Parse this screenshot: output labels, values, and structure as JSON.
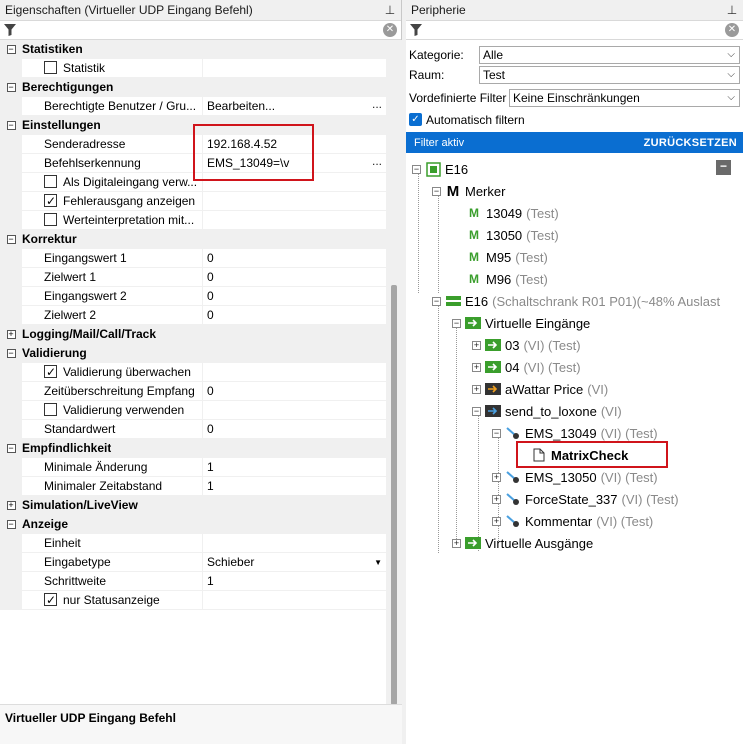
{
  "left_panel": {
    "title": "Eigenschaften (Virtueller UDP Eingang Befehl)",
    "description": "Virtueller UDP Eingang Befehl"
  },
  "right_panel": {
    "title": "Peripherie",
    "kategorie_label": "Kategorie:",
    "kategorie_value": "Alle",
    "raum_label": "Raum:",
    "raum_value": "Test",
    "vordef_label": "Vordefinierte Filter",
    "vordef_value": "Keine Einschränkungen",
    "auto_filter": "Automatisch filtern",
    "filter_active": "Filter aktiv",
    "reset": "ZURÜCKSETZEN"
  },
  "props": [
    {
      "t": "cat",
      "name": "Statistiken"
    },
    {
      "t": "cb",
      "name": "Statistik",
      "checked": false,
      "val": ""
    },
    {
      "t": "cat",
      "name": "Berechtigungen"
    },
    {
      "t": "row",
      "name": "Berechtigte Benutzer / Gru...",
      "val": "Bearbeiten...",
      "ell": true
    },
    {
      "t": "cat",
      "name": "Einstellungen"
    },
    {
      "t": "row",
      "name": "Senderadresse",
      "val": "192.168.4.52"
    },
    {
      "t": "row",
      "name": "Befehlserkennung",
      "val": "EMS_13049=\\v",
      "ell": true
    },
    {
      "t": "cb",
      "name": "Als Digitaleingang verw...",
      "checked": false,
      "val": ""
    },
    {
      "t": "cb",
      "name": "Fehlerausgang anzeigen",
      "checked": true,
      "val": ""
    },
    {
      "t": "cb",
      "name": "Werteinterpretation mit...",
      "checked": false,
      "val": ""
    },
    {
      "t": "cat",
      "name": "Korrektur"
    },
    {
      "t": "row",
      "name": "Eingangswert 1",
      "val": "0"
    },
    {
      "t": "row",
      "name": "Zielwert 1",
      "val": "0"
    },
    {
      "t": "row",
      "name": "Eingangswert 2",
      "val": "0"
    },
    {
      "t": "row",
      "name": "Zielwert 2",
      "val": "0"
    },
    {
      "t": "catc",
      "name": "Logging/Mail/Call/Track"
    },
    {
      "t": "cat",
      "name": "Validierung"
    },
    {
      "t": "cb",
      "name": "Validierung überwachen",
      "checked": true,
      "val": ""
    },
    {
      "t": "row",
      "name": "Zeitüberschreitung Empfang",
      "val": "0"
    },
    {
      "t": "cb",
      "name": "Validierung verwenden",
      "checked": false,
      "val": ""
    },
    {
      "t": "row",
      "name": "Standardwert",
      "val": "0"
    },
    {
      "t": "cat",
      "name": "Empfindlichkeit"
    },
    {
      "t": "row",
      "name": "Minimale Änderung",
      "val": "1"
    },
    {
      "t": "row",
      "name": "Minimaler Zeitabstand",
      "val": "1"
    },
    {
      "t": "catc",
      "name": "Simulation/LiveView"
    },
    {
      "t": "cat",
      "name": "Anzeige"
    },
    {
      "t": "row",
      "name": "Einheit",
      "val": ""
    },
    {
      "t": "row",
      "name": "Eingabetype",
      "val": "Schieber",
      "dd": true
    },
    {
      "t": "row",
      "name": "Schrittweite",
      "val": "1"
    },
    {
      "t": "cb",
      "name": "nur Statusanzeige",
      "checked": true,
      "val": ""
    }
  ],
  "tree": {
    "e16": "E16",
    "merker": "Merker",
    "m1": "13049",
    "m1s": "(Test)",
    "m2": "13050",
    "m2s": "(Test)",
    "m3": "M95",
    "m3s": "(Test)",
    "m4": "M96",
    "m4s": "(Test)",
    "e16b": "E16",
    "e16bs": "(Schaltschrank R01 P01)(~48% Auslast",
    "ve": "Virtuelle Eingänge",
    "v1": "03",
    "v1s": "(VI) (Test)",
    "v2": "04",
    "v2s": "(VI) (Test)",
    "v3": "aWattar Price",
    "v3s": "(VI)",
    "v4": "send_to_loxone",
    "v4s": "(VI)",
    "c1": "EMS_13049",
    "c1s": "(VI) (Test)",
    "mc": "MatrixCheck",
    "c2": "EMS_13050",
    "c2s": "(VI) (Test)",
    "c3": "ForceState_337",
    "c3s": "(VI) (Test)",
    "c4": "Kommentar",
    "c4s": "(VI) (Test)",
    "va": "Virtuelle Ausgänge"
  },
  "colors": {
    "accent": "#0a6ed1",
    "highlight": "#d0141b",
    "green": "#3a9e2c"
  }
}
